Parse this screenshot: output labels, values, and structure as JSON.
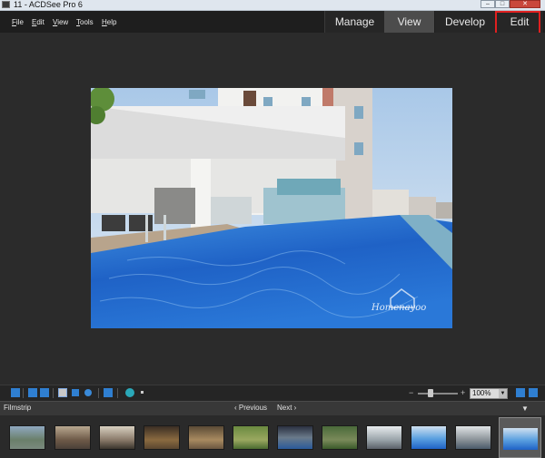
{
  "window": {
    "title": "11 - ACDSee Pro 6",
    "minimize": "–",
    "maximize": "□",
    "close": "✕"
  },
  "menu": {
    "items": [
      "File",
      "Edit",
      "View",
      "Tools",
      "Help"
    ]
  },
  "modes": {
    "manage": "Manage",
    "view": "View",
    "develop": "Develop",
    "edit": "Edit",
    "active": "View"
  },
  "annotation": {
    "step": "1",
    "color": "#e02020",
    "step_color": "#ef8a1a"
  },
  "viewer": {
    "watermark": "Homenayoo"
  },
  "toolbar": {
    "zoom_minus": "−",
    "zoom_plus": "+",
    "zoom_value": "100%",
    "zoom_level": 0.3
  },
  "filmstrip": {
    "title": "Filmstrip",
    "previous": "‹ Previous",
    "next": "Next ›",
    "collapse": "▼",
    "selected_index": 11,
    "thumbs": [
      "building-exterior",
      "building-terrace",
      "lobby",
      "lounge",
      "lounge-2",
      "garden",
      "pool-night",
      "garden-2",
      "building-front",
      "pool-1",
      "building-2",
      "pool-2"
    ]
  },
  "icons": [
    "filmstrip-icon",
    "fit-icon",
    "actual-size-icon",
    "hand-icon",
    "select-icon",
    "zoom-icon",
    "fullscreen-icon",
    "eye-icon",
    "dropdown-icon",
    "tile-icon",
    "rotate-icon"
  ]
}
